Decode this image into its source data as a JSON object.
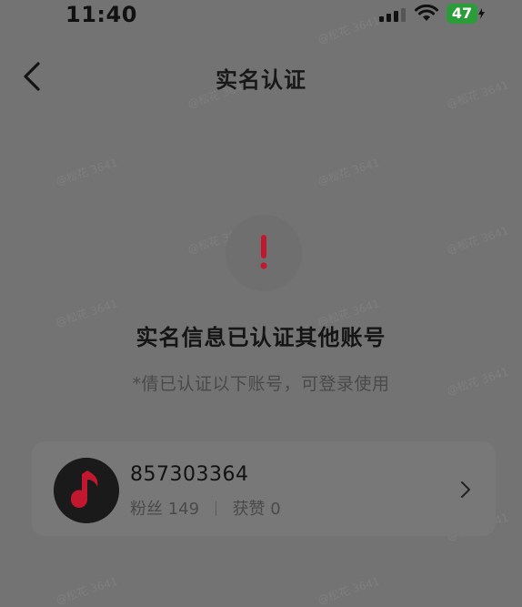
{
  "status_bar": {
    "time": "11:40",
    "battery": "47",
    "icons": [
      "signal-icon",
      "wifi-icon",
      "battery-charging-icon"
    ],
    "battery_color": "#2a9d3a"
  },
  "nav": {
    "title": "实名认证",
    "back_icon": "back-chevron-icon"
  },
  "warning": {
    "icon": "exclamation-icon",
    "icon_color": "#c2182f",
    "heading": "实名信息已认证其他账号",
    "note": "*倩已认证以下账号，可登录使用"
  },
  "account": {
    "id": "857303364",
    "fans_label": "粉丝",
    "fans_count": "149",
    "likes_label": "获赞",
    "likes_count": "0",
    "avatar_icon": "music-note-icon",
    "chevron_icon": "chevron-right-icon"
  },
  "watermark": {
    "text": "@松花 3641"
  },
  "colors": {
    "background": "#737373",
    "card": "#787878",
    "accent": "#c2182f"
  }
}
